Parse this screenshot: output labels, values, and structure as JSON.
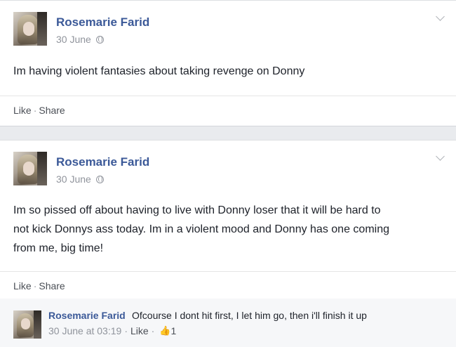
{
  "posts": [
    {
      "author": "Rosemarie Farid",
      "date": "30 June",
      "privacy_icon": "globe-icon",
      "text": "Im having violent fantasies about taking revenge on Donny",
      "actions": {
        "like": "Like",
        "separator": "·",
        "share": "Share"
      }
    },
    {
      "author": "Rosemarie Farid",
      "date": "30 June",
      "privacy_icon": "globe-icon",
      "text_lines": [
        "Im so pissed off about having to live with Donny loser that it will be hard to",
        "not kick Donnys ass today. Im in a violent mood and Donny has one coming",
        "from me, big time!"
      ],
      "actions": {
        "like": "Like",
        "separator": "·",
        "share": "Share"
      },
      "comment": {
        "author": "Rosemarie Farid",
        "text": "Ofcourse I dont hit first, I let him go, then i'll finish it up",
        "timestamp": "30 June at 03:19",
        "separator": "·",
        "like": "Like",
        "like_count": "1",
        "like_icon": "thumbs-up-icon"
      }
    }
  ],
  "colors": {
    "name_blue": "#3b5998",
    "meta_gray": "#90949c",
    "text": "#1d2129",
    "background": "#e9ebee"
  }
}
